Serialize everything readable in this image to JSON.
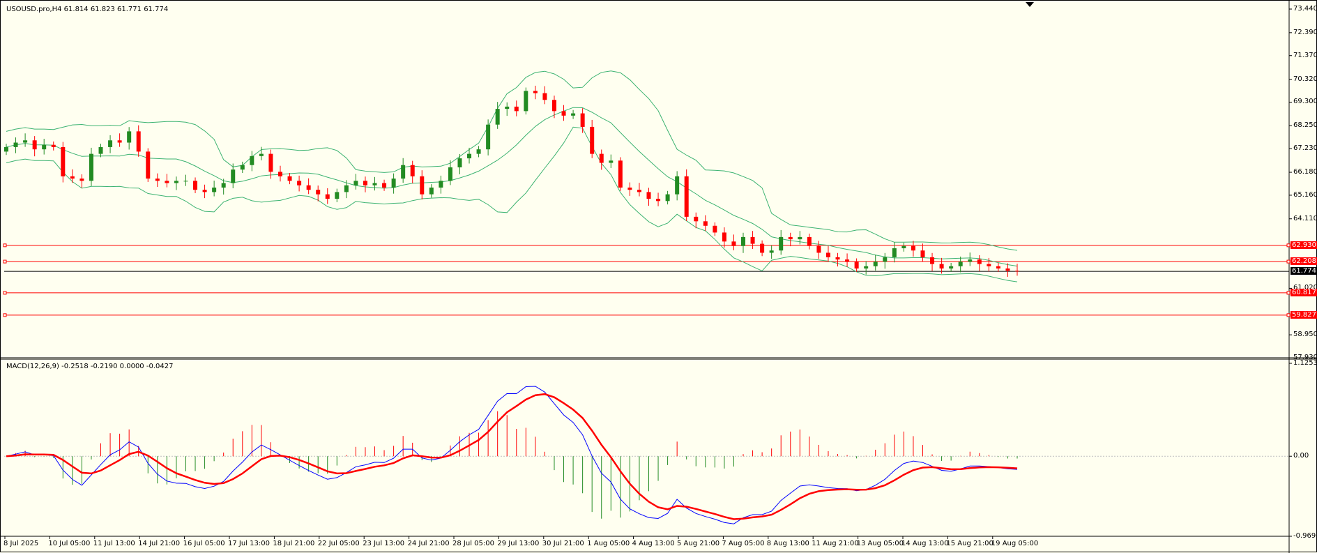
{
  "header": {
    "symbol_info": "USOUSD.pro,H4  61.814 61.823 61.771 61.774"
  },
  "macd": {
    "title": "MACD(12,26,9) -0.2518 -0.2190 0.0000 -0.0427"
  },
  "price_axis": {
    "ticks": [
      "73.440",
      "72.390",
      "71.370",
      "70.320",
      "69.300",
      "68.250",
      "67.230",
      "66.180",
      "65.160",
      "64.110",
      "61.020",
      "58.950",
      "57.930"
    ],
    "levels": [
      {
        "label": "62.930",
        "value": 62.93,
        "color": "#ff0000"
      },
      {
        "label": "62.208",
        "value": 62.208,
        "color": "#ff0000"
      },
      {
        "label": "61.774",
        "value": 61.774,
        "color": "#000000"
      },
      {
        "label": "60.817",
        "value": 60.817,
        "color": "#ff0000"
      },
      {
        "label": "59.827",
        "value": 59.827,
        "color": "#ff0000"
      }
    ]
  },
  "macd_axis": {
    "ticks": [
      "1.1253",
      "0.00",
      "-0.9694"
    ]
  },
  "time_axis": {
    "labels": [
      "8 Jul 2025",
      "10 Jul 05:00",
      "11 Jul 13:00",
      "14 Jul 21:00",
      "16 Jul 05:00",
      "17 Jul 13:00",
      "18 Jul 21:00",
      "22 Jul 05:00",
      "23 Jul 13:00",
      "24 Jul 21:00",
      "28 Jul 05:00",
      "29 Jul 13:00",
      "30 Jul 21:00",
      "1 Aug 05:00",
      "4 Aug 13:00",
      "5 Aug 21:00",
      "7 Aug 05:00",
      "8 Aug 13:00",
      "11 Aug 21:00",
      "13 Aug 05:00",
      "14 Aug 13:00",
      "15 Aug 21:00",
      "19 Aug 05:00"
    ]
  },
  "colors": {
    "background": "#fffff0",
    "bull": "#228b22",
    "bear": "#ff0000",
    "bands": "#3cb371",
    "macd_line": "#0000ff",
    "signal_line": "#ff0000"
  },
  "chart_data": {
    "type": "candlestick",
    "price_range": [
      57.93,
      73.44
    ],
    "close_path": [
      67.3,
      67.5,
      67.6,
      67.2,
      67.4,
      67.3,
      66.0,
      65.9,
      65.8,
      67.0,
      67.3,
      67.6,
      67.5,
      68.0,
      67.1,
      65.9,
      65.8,
      65.7,
      65.8,
      65.8,
      65.4,
      65.3,
      65.5,
      65.7,
      66.3,
      66.5,
      66.9,
      67.0,
      66.2,
      66.0,
      65.8,
      65.6,
      65.4,
      65.2,
      65.0,
      65.3,
      65.6,
      65.8,
      65.6,
      65.7,
      65.5,
      65.9,
      66.5,
      66.0,
      65.2,
      65.5,
      65.8,
      66.4,
      66.8,
      67.0,
      67.2,
      68.3,
      69.0,
      69.1,
      68.9,
      69.8,
      69.7,
      69.4,
      68.9,
      68.7,
      68.8,
      68.2,
      67.0,
      66.6,
      66.7,
      65.5,
      65.4,
      65.3,
      65.0,
      64.9,
      65.2,
      66.0,
      64.2,
      64.0,
      63.8,
      63.5,
      63.1,
      62.9,
      63.3,
      63.0,
      62.6,
      62.7,
      63.3,
      63.2,
      63.3,
      62.9,
      62.6,
      62.4,
      62.3,
      62.2,
      61.9,
      62.0,
      62.2,
      62.4,
      62.8,
      62.9,
      62.7,
      62.4,
      62.1,
      61.9,
      62.0,
      62.2,
      62.3,
      62.1,
      62.0,
      61.9,
      61.8,
      61.77
    ],
    "series": [
      {
        "name": "MACD",
        "type": "line"
      },
      {
        "name": "Signal",
        "type": "line"
      },
      {
        "name": "Histogram",
        "type": "bar"
      }
    ],
    "macd_range": [
      -0.9694,
      1.1253
    ]
  }
}
